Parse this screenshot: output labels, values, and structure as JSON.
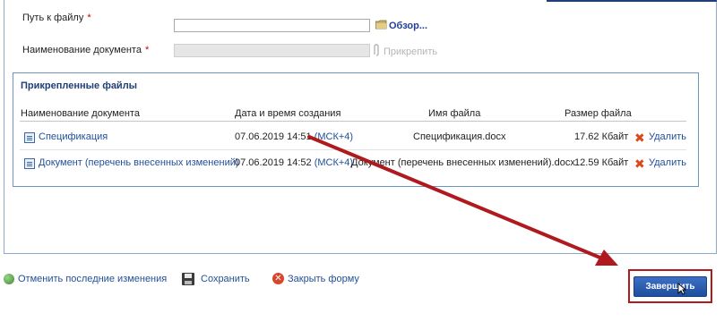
{
  "form": {
    "path_label": "Путь к файлу",
    "required_mark": "*",
    "path_value": "",
    "browse_label": "Обзор...",
    "docname_label": "Наименование документа",
    "docname_value": "",
    "attach_label": "Прикрепить"
  },
  "attached_files": {
    "title": "Прикрепленные файлы",
    "columns": [
      "Наименование документа",
      "Дата и время создания",
      "Имя файла",
      "Размер файла"
    ],
    "rows": [
      {
        "name": "Спецификация",
        "datetime": "07.06.2019 14:51",
        "tz": "(МСК+4)",
        "filename": "Спецификация.docx",
        "size": "17.62 Кбайт",
        "delete_label": "Удалить"
      },
      {
        "name": "Документ (перечень внесенных изменений)",
        "datetime": "07.06.2019 14:52",
        "tz": "(МСК+4)",
        "filename": "Документ (перечень внесенных изменений).docx",
        "size": "12.59 Кбайт",
        "delete_label": "Удалить"
      }
    ]
  },
  "toolbar": {
    "undo_label": "Отменить последние изменения",
    "save_label": "Сохранить",
    "close_label": "Закрыть форму",
    "finish_label": "Завершить"
  },
  "colors": {
    "annotation_arrow": "#b0191e",
    "panel_border": "#8fa8c8",
    "link": "#1f4f9a",
    "button": "#1e4e9e"
  },
  "icons": {
    "folder": "folder-icon",
    "paperclip": "paperclip-icon",
    "document": "document-icon",
    "delete": "delete-icon",
    "undo": "undo-icon",
    "save": "save-icon",
    "close": "close-icon",
    "cursor": "mouse-cursor-icon"
  }
}
